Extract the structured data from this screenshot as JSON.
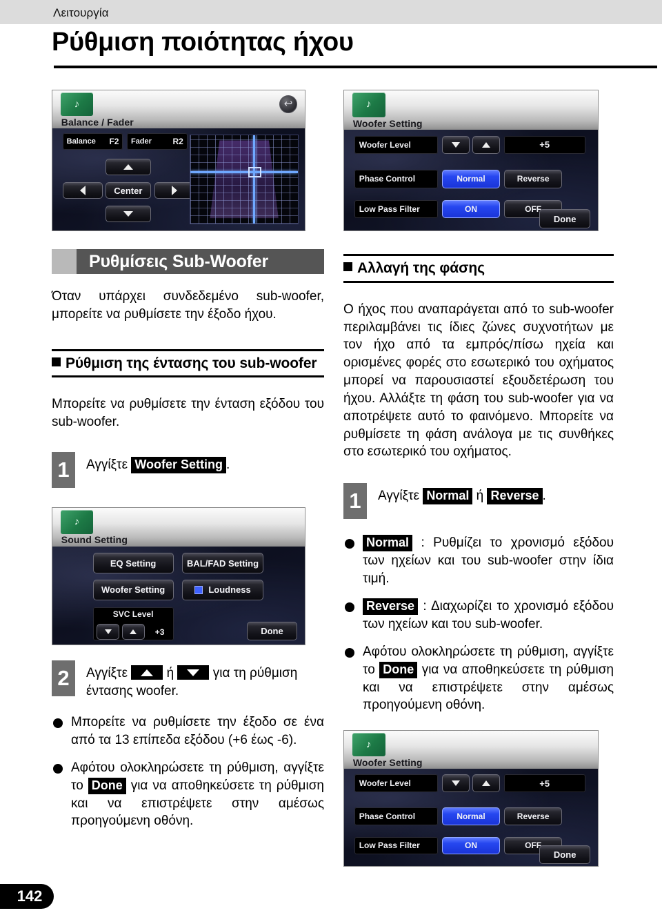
{
  "header": {
    "kicker": "Λειτουργία",
    "title": "Ρύθμιση ποιότητας ήχου"
  },
  "page_number": "142",
  "screens": {
    "balance_fader": {
      "title": "Balance / Fader",
      "icon": "music-note-icon",
      "back_icon": "back-arrow-icon",
      "balance_label": "Balance",
      "balance_value": "F2",
      "fader_label": "Fader",
      "fader_value": "R2",
      "center_label": "Center",
      "up_icon": "arrow-up-icon",
      "down_icon": "arrow-down-icon",
      "left_icon": "arrow-left-icon",
      "right_icon": "arrow-right-icon"
    },
    "woofer_setting": {
      "title": "Woofer Setting",
      "icon": "music-note-icon",
      "woofer_level_label": "Woofer Level",
      "woofer_level_value": "+5",
      "down_icon": "arrow-down-icon",
      "up_icon": "arrow-up-icon",
      "phase_control_label": "Phase Control",
      "phase_normal": "Normal",
      "phase_reverse": "Reverse",
      "low_pass_label": "Low Pass Filter",
      "low_pass_on": "ON",
      "low_pass_off": "OFF",
      "done": "Done"
    },
    "sound_setting": {
      "title": "Sound Setting",
      "icon": "music-note-icon",
      "eq_setting": "EQ Setting",
      "bal_fad_setting": "BAL/FAD Setting",
      "woofer_setting": "Woofer Setting",
      "loudness": "Loudness",
      "svc_level_label": "SVC Level",
      "svc_level_value": "+3",
      "down_icon": "arrow-down-icon",
      "up_icon": "arrow-up-icon",
      "done": "Done"
    }
  },
  "left": {
    "section_title": "Ρυθμίσεις Sub-Woofer",
    "intro": "Όταν υπάρχει συνδεδεμένο sub-woofer, μπορείτε να ρυθμίσετε την έξοδο ήχου.",
    "subhead": "Ρύθμιση της έντασης του sub-woofer",
    "body": "Μπορείτε να ρυθμίσετε την ένταση εξόδου του sub-woofer.",
    "step1_num": "1",
    "step1_pre": "Αγγίξτε ",
    "step1_key": "Woofer Setting",
    "step1_post": ".",
    "step2_num": "2",
    "step2_a": "Αγγίξτε ",
    "step2_or": " ή ",
    "step2_b": " για τη ρύθμιση έντασης woofer.",
    "bullet1": "Μπορείτε να ρυθμίσετε την έξοδο σε ένα από τα 13 επίπεδα εξόδου (+6 έως -6).",
    "bullet2_a": "Αφότου ολοκληρώσετε τη ρύθμιση, αγγίξτε το ",
    "bullet2_key": "Done",
    "bullet2_b": " για να αποθηκεύσετε τη ρύθμιση και να επιστρέψετε στην αμέσως προηγούμενη οθόνη."
  },
  "right": {
    "subhead": "Αλλαγή της φάσης",
    "body": "Ο ήχος που αναπαράγεται από το sub-woofer περιλαμβάνει τις ίδιες ζώνες συχνοτήτων με τον ήχο από τα εμπρός/πίσω ηχεία και ορισμένες φορές στο εσωτερικό του οχήματος μπορεί να παρουσιαστεί εξουδετέρωση του ήχου. Αλλάξτε τη φάση του sub-woofer για να αποτρέψετε αυτό το φαινόμενο. Μπορείτε να ρυθμίσετε τη φάση ανάλογα με τις συνθήκες στο εσωτερικό του οχήματος.",
    "step1_num": "1",
    "step1_pre": "Αγγίξτε ",
    "step1_key_a": "Normal",
    "step1_or": " ή ",
    "step1_key_b": "Reverse",
    "step1_post": ".",
    "bullet1_key": "Normal",
    "bullet1_text": " : Ρυθμίζει το χρονισμό εξόδου των ηχείων και του sub-woofer στην ίδια τιμή.",
    "bullet2_key": "Reverse",
    "bullet2_text": " : Διαχωρίζει το χρονισμό εξόδου των ηχείων και του sub-woofer.",
    "bullet3_a": "Αφότου ολοκληρώσετε τη ρύθμιση, αγγίξτε το ",
    "bullet3_key": "Done",
    "bullet3_b": " για να αποθηκεύσετε τη ρύθμιση και να επιστρέψετε στην αμέσως προηγούμενη οθόνη."
  },
  "colors": {
    "section_bar": "#555555",
    "section_square": "#b9b9b9",
    "step_num_bg": "#6e6e6e",
    "topbar": "#dcdcdc",
    "accent_blue": "#2647f0",
    "icon_green": "#1d7a46"
  }
}
